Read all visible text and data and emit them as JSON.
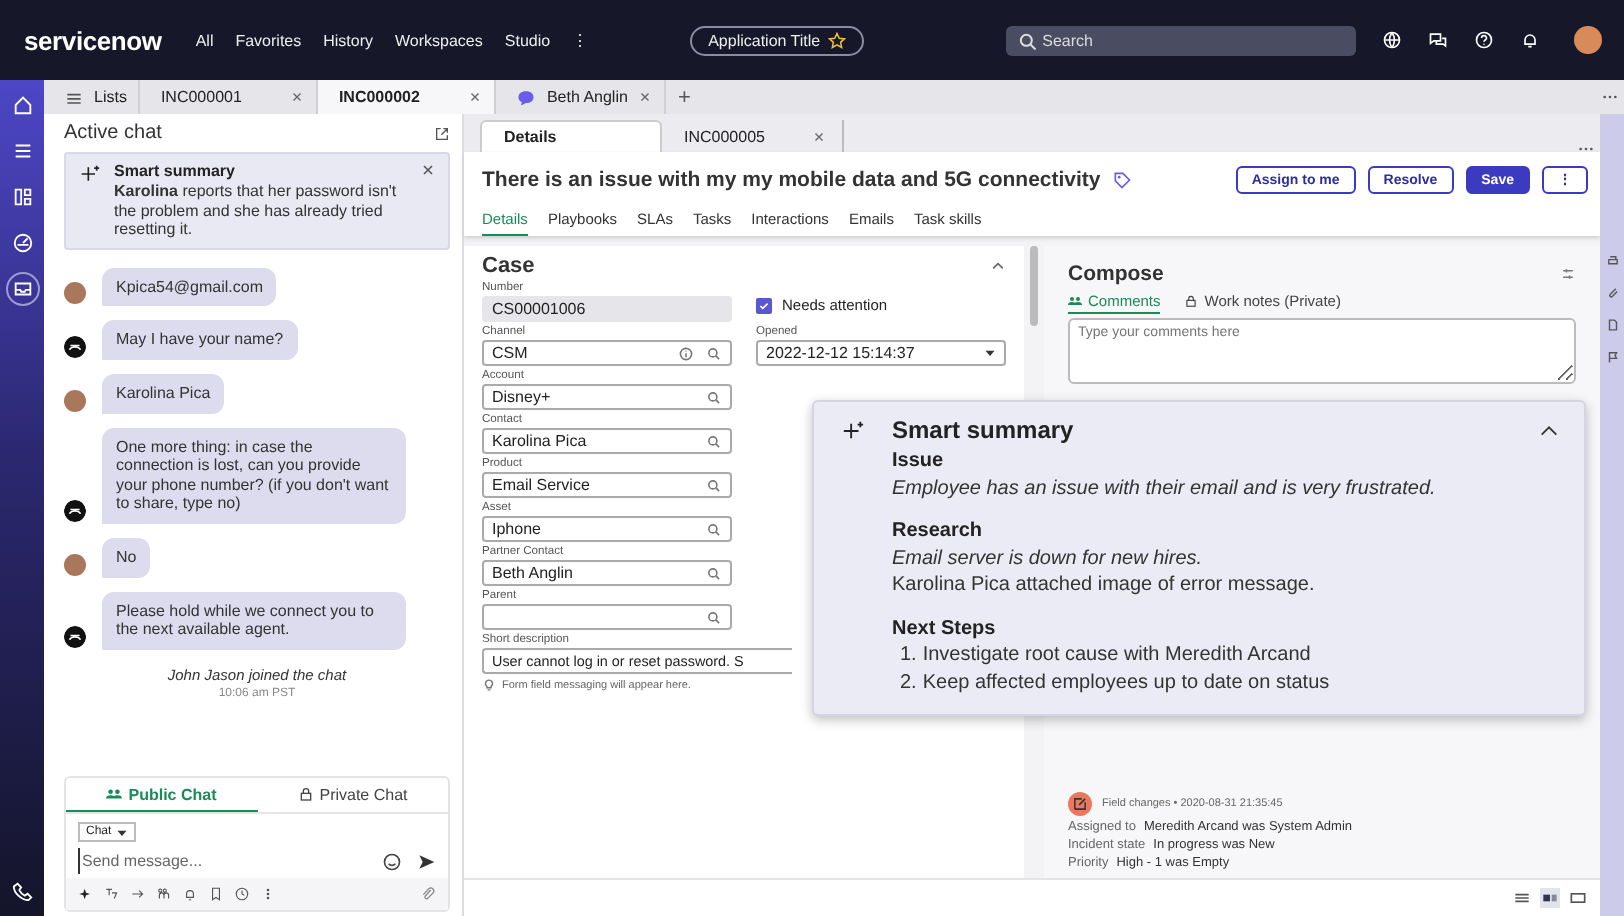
{
  "top_nav": {
    "logo": "servicenow",
    "menu": [
      "All",
      "Favorites",
      "History",
      "Workspaces",
      "Studio",
      "⋮"
    ],
    "app_title": "Application Title",
    "search": {
      "placeholder": "Search"
    }
  },
  "workspace_tabs": [
    {
      "label": "Lists",
      "kind": "list",
      "selected": false
    },
    {
      "label": "INC000001",
      "kind": "record",
      "selected": false
    },
    {
      "label": "INC000002",
      "kind": "record",
      "selected": true
    },
    {
      "label": "Beth Anglin",
      "kind": "chat",
      "selected": false
    }
  ],
  "new_tab": "+",
  "chat": {
    "title": "Active chat",
    "summary": {
      "title": "Smart summary",
      "text": "**Karolina** reports that her password isn't the problem and she has already tried resetting it."
    },
    "messages": [
      {
        "kind": "user",
        "text": "Kpica54@gmail.com"
      },
      {
        "kind": "agent",
        "text": "May I have your name?"
      },
      {
        "kind": "user",
        "text": "Karolina Pica"
      },
      {
        "kind": "agent",
        "text": "One more thing: in case the connection is lost, can you provide your phone number? (if you don't want to share, type no)"
      },
      {
        "kind": "user",
        "text": "No"
      },
      {
        "kind": "agent",
        "text": "Please hold while we connect you to the next available agent."
      }
    ],
    "system": {
      "text": "John Jason joined the chat",
      "time": "10:06 am PST"
    },
    "composer": {
      "tabs": [
        {
          "label": "Public Chat",
          "kind": "public",
          "selected": true
        },
        {
          "label": "Private Chat",
          "kind": "private",
          "selected": false
        }
      ],
      "channel": "Chat",
      "placeholder": "Send message..."
    }
  },
  "record": {
    "subtabs": [
      {
        "label": "Details",
        "closable": false,
        "selected": true
      },
      {
        "label": "INC000005",
        "closable": true,
        "selected": false
      }
    ],
    "title": "There is an issue with my my mobile data and 5G connectivity",
    "actions": [
      {
        "label": "Assign to me",
        "kind": "secondary"
      },
      {
        "label": "Resolve",
        "kind": "secondary"
      },
      {
        "label": "Save",
        "kind": "primary"
      },
      {
        "label": "⋮",
        "kind": "secondary"
      }
    ],
    "tabs": [
      {
        "label": "Details",
        "selected": true
      },
      {
        "label": "Playbooks",
        "selected": false
      },
      {
        "label": "SLAs",
        "selected": false
      },
      {
        "label": "Tasks",
        "selected": false
      },
      {
        "label": "Interactions",
        "selected": false
      },
      {
        "label": "Emails",
        "selected": false
      },
      {
        "label": "Task skills",
        "selected": false
      }
    ],
    "form": {
      "title": "Case",
      "fields": [
        {
          "label": "Number",
          "value": "CS00001006",
          "kind": "readonly"
        },
        {
          "label": "Channel",
          "value": "CSM",
          "kind": "info_lookup"
        },
        {
          "label": "Account",
          "value": "Disney+",
          "kind": "lookup"
        },
        {
          "label": "Contact",
          "value": "Karolina Pica",
          "kind": "lookup"
        },
        {
          "label": "Product",
          "value": "Email Service",
          "kind": "lookup"
        },
        {
          "label": "Asset",
          "value": "Iphone",
          "kind": "lookup"
        },
        {
          "label": "Partner Contact",
          "value": "Beth Anglin",
          "kind": "lookup"
        },
        {
          "label": "Parent",
          "kind": "lookup"
        }
      ],
      "needs_attention": {
        "label": "Needs attention",
        "checked": true
      },
      "opened": {
        "label": "Opened",
        "value": "2022-12-12 15:14:37"
      },
      "short_description": {
        "label": "Short description",
        "value": "User cannot log in or reset password. S"
      },
      "hint": "Form field messaging will appear here."
    },
    "compose": {
      "title": "Compose",
      "tabs": [
        {
          "label": "Comments",
          "kind": "public",
          "selected": true
        },
        {
          "label": "Work notes (Private)",
          "kind": "private",
          "selected": false
        }
      ],
      "placeholder": "Type your comments here",
      "activity": {
        "meta": "Field changes  •  2020-08-31 21:35:45",
        "changes": [
          {
            "field": "Assigned to",
            "text": "Meredith Arcand was System Admin"
          },
          {
            "field": "Incident state",
            "text": "In progress was New"
          },
          {
            "field": "Priority",
            "text": "High - 1 was Empty"
          }
        ]
      }
    }
  },
  "smart_summary": {
    "title": "Smart summary",
    "expanded": true,
    "sections": [
      {
        "heading": "Issue",
        "kind": "text",
        "lines": [
          {
            "text": "Employee has an issue with their email and is very frustrated.",
            "italic": true
          }
        ]
      },
      {
        "heading": "Research",
        "kind": "text",
        "lines": [
          {
            "text": "Email server is down for new hires.",
            "italic": true
          },
          {
            "text": "Karolina Pica attached image of error message.",
            "italic": false
          }
        ]
      },
      {
        "heading": "Next Steps",
        "kind": "list",
        "lines": [
          {
            "number": "1.",
            "text": "Investigate root cause with Meredith Arcand",
            "italic": false
          },
          {
            "number": "2.",
            "text": "Keep affected employees up to date on status",
            "italic": false
          }
        ]
      }
    ]
  }
}
